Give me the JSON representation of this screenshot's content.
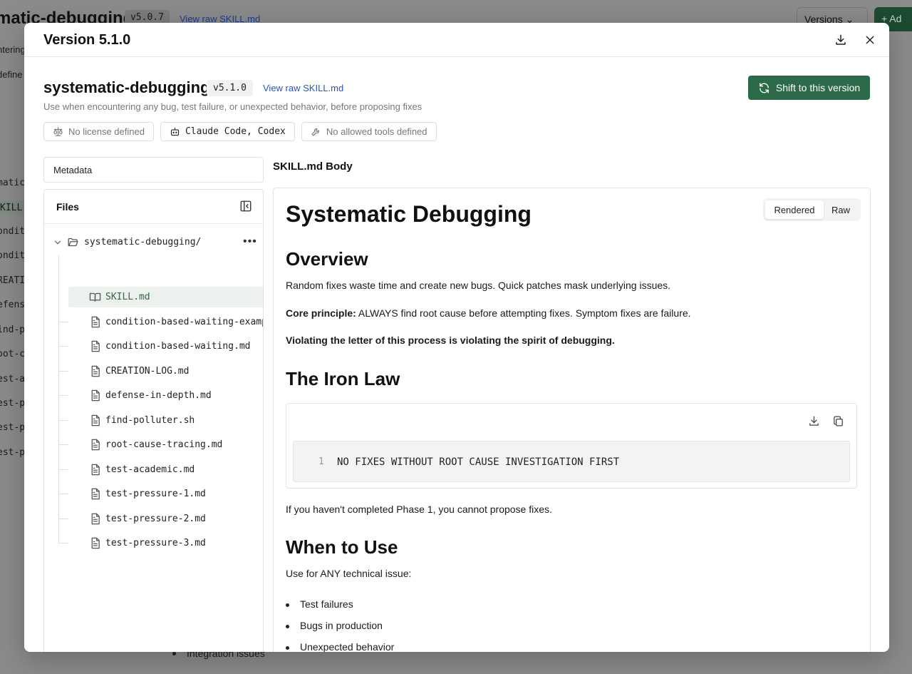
{
  "background": {
    "title": "matic-debugging",
    "version": "v5.0.7",
    "raw_link": "View raw SKILL.md",
    "versions_button": "Versions",
    "add_button": "+ Ad",
    "side_items": [
      "ntering",
      "define",
      "matic",
      "KILL.",
      "ondit",
      "ondit",
      "REATI",
      "efens",
      "ind-p",
      "oot-c",
      "est-a",
      "est-p",
      "est-p",
      "est-p"
    ],
    "bottom_text": "Integration issues"
  },
  "modal": {
    "title": "Version 5.1.0",
    "skill": {
      "name": "systematic-debugging",
      "version": "v5.1.0",
      "raw_link": "View raw SKILL.md",
      "description": "Use when encountering any bug, test failure, or unexpected behavior, before proposing fixes",
      "shift_button": "Shift to this version"
    },
    "chips": {
      "license": "No license defined",
      "agents": "Claude Code, Codex",
      "tools": "No allowed tools defined"
    },
    "metadata_label": "Metadata",
    "files": {
      "title": "Files",
      "folder": "systematic-debugging/",
      "items": [
        {
          "name": "SKILL.md",
          "icon": "book-icon"
        },
        {
          "name": "condition-based-waiting-examp",
          "icon": "file-icon"
        },
        {
          "name": "condition-based-waiting.md",
          "icon": "file-icon"
        },
        {
          "name": "CREATION-LOG.md",
          "icon": "file-icon"
        },
        {
          "name": "defense-in-depth.md",
          "icon": "file-icon"
        },
        {
          "name": "find-polluter.sh",
          "icon": "file-icon"
        },
        {
          "name": "root-cause-tracing.md",
          "icon": "file-icon"
        },
        {
          "name": "test-academic.md",
          "icon": "file-icon"
        },
        {
          "name": "test-pressure-1.md",
          "icon": "file-icon"
        },
        {
          "name": "test-pressure-2.md",
          "icon": "file-icon"
        },
        {
          "name": "test-pressure-3.md",
          "icon": "file-icon"
        }
      ],
      "active_index": 0
    },
    "body": {
      "label": "SKILL.md Body",
      "toggle": {
        "rendered": "Rendered",
        "raw": "Raw",
        "selected": "Rendered"
      },
      "h1": "Systematic Debugging",
      "overview_heading": "Overview",
      "overview_p1": "Random fixes waste time and create new bugs. Quick patches mask underlying issues.",
      "core_label": "Core principle:",
      "core_text": " ALWAYS find root cause before attempting fixes. Symptom fixes are failure.",
      "violating": "Violating the letter of this process is violating the spirit of debugging.",
      "iron_heading": "The Iron Law",
      "code_line_no": "1",
      "code_line": "NO FIXES WITHOUT ROOT CAUSE INVESTIGATION FIRST",
      "phase_text": "If you haven't completed Phase 1, you cannot propose fixes.",
      "when_heading": "When to Use",
      "when_p": "Use for ANY technical issue:",
      "bullets": [
        "Test failures",
        "Bugs in production",
        "Unexpected behavior"
      ]
    },
    "colors": {
      "accent": "#2d6a4a",
      "link": "#2455c9"
    }
  }
}
